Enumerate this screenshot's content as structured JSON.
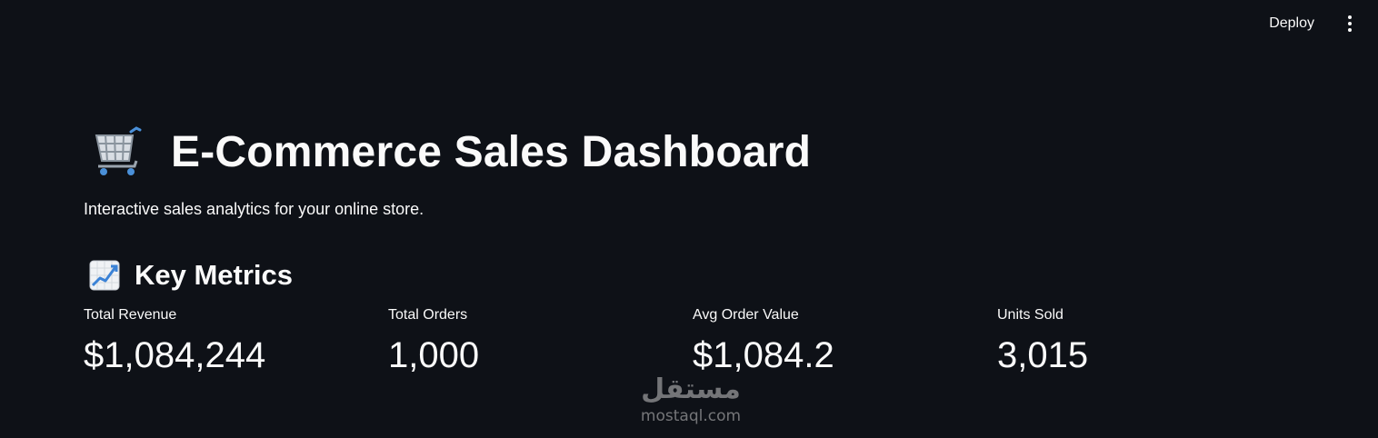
{
  "toolbar": {
    "deploy_label": "Deploy",
    "menu_icon": "kebab-menu-icon"
  },
  "header": {
    "title_icon": "shopping-cart-icon",
    "title": "E-Commerce Sales Dashboard",
    "subtitle": "Interactive sales analytics for your online store."
  },
  "key_metrics": {
    "section_icon": "chart-increasing-icon",
    "title": "Key Metrics",
    "items": [
      {
        "label": "Total Revenue",
        "value": "$1,084,244"
      },
      {
        "label": "Total Orders",
        "value": "1,000"
      },
      {
        "label": "Avg Order Value",
        "value": "$1,084.2"
      },
      {
        "label": "Units Sold",
        "value": "3,015"
      }
    ]
  },
  "watermark": {
    "arabic": "مستقل",
    "latin": "mostaql.com"
  },
  "colors": {
    "background": "#0e1117",
    "text": "#fafafa"
  }
}
